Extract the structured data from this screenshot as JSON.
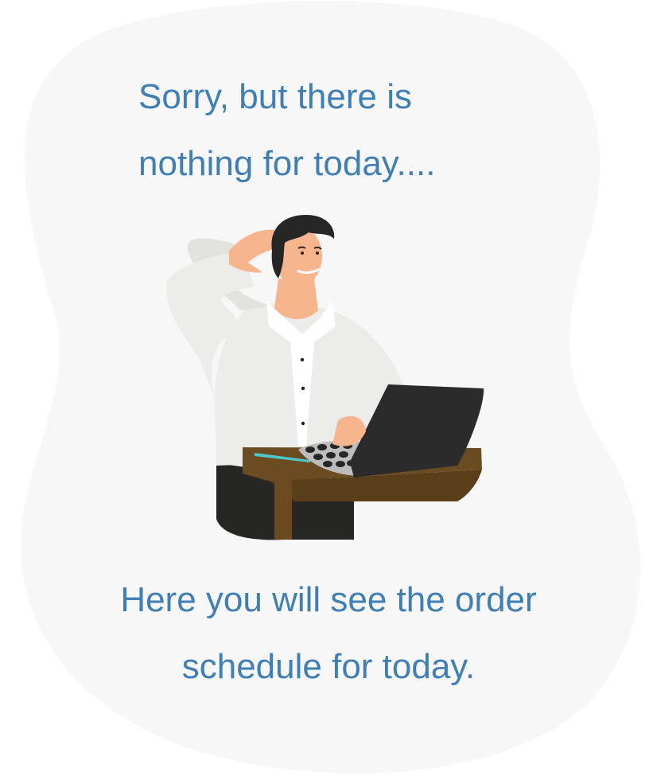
{
  "empty_state": {
    "headline_line1": "Sorry, but there is",
    "headline_line2": "nothing for today....",
    "message_line1": "Here you will see the order",
    "message_line2": "schedule for today."
  },
  "colors": {
    "text": "#3f7fb3",
    "blob": "#f7f7f7",
    "shirt": "#ececea",
    "skin": "#f6b58d",
    "hair": "#262626",
    "laptop": "#2b2b2b",
    "desk": "#6b4b22",
    "pen": "#4fc7c9"
  },
  "illustration": {
    "icon": "confused-man-laptop-illustration"
  }
}
